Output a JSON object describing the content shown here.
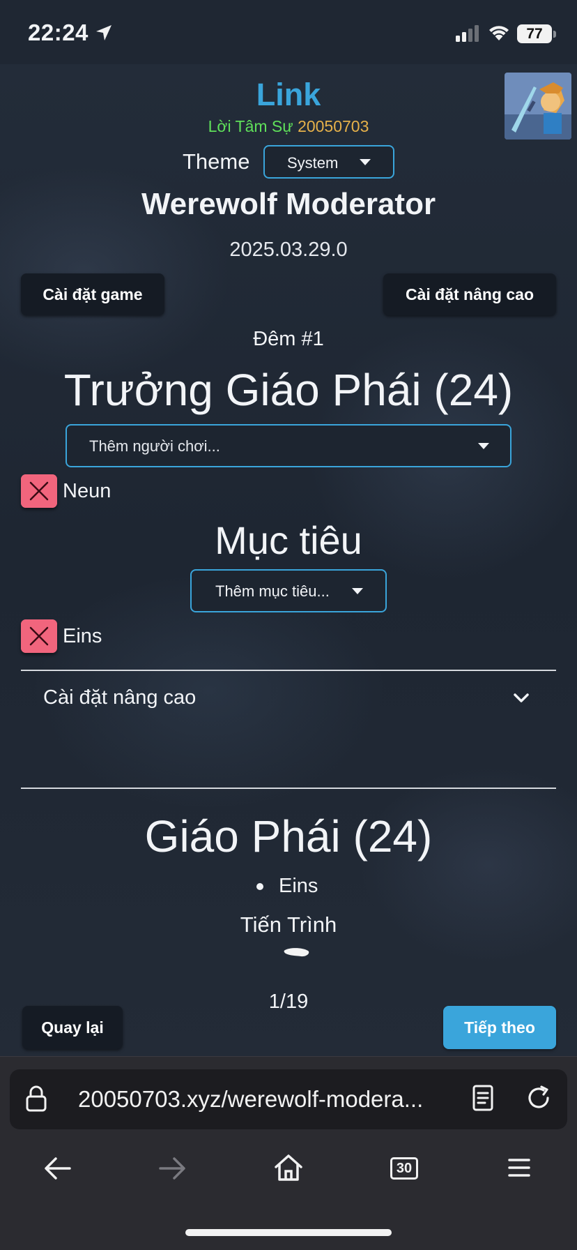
{
  "status_bar": {
    "time": "22:24",
    "battery": "77"
  },
  "header": {
    "title": "Link",
    "subtitle_green": "Lời Tâm Sự",
    "subtitle_orange": "20050703",
    "theme_label": "Theme",
    "theme_value": "System",
    "app_title": "Werewolf Moderator",
    "version": "2025.03.29.0"
  },
  "buttons": {
    "game_settings": "Cài đặt game",
    "advanced_settings": "Cài đặt nâng cao"
  },
  "night": {
    "label": "Đêm #1",
    "role_title": "Trưởng Giáo Phái (24)",
    "player_select_placeholder": "Thêm người chơi...",
    "players": [
      "Neun"
    ],
    "target_title": "Mục tiêu",
    "target_select_placeholder": "Thêm mục tiêu...",
    "targets": [
      "Eins"
    ]
  },
  "advanced": {
    "label": "Cài đặt nâng cao"
  },
  "faction": {
    "title": "Giáo Phái (24)",
    "members": [
      "Eins"
    ],
    "progress_label": "Tiến Trình",
    "page": "1/19"
  },
  "footer": {
    "back": "Quay lại",
    "next": "Tiếp theo"
  },
  "browser": {
    "url": "20050703.xyz/werewolf-modera...",
    "tabs_count": "30"
  },
  "colors": {
    "accent": "#3aa5db",
    "danger": "#f1657d",
    "green": "#5fe05a",
    "orange": "#e6b14a"
  }
}
